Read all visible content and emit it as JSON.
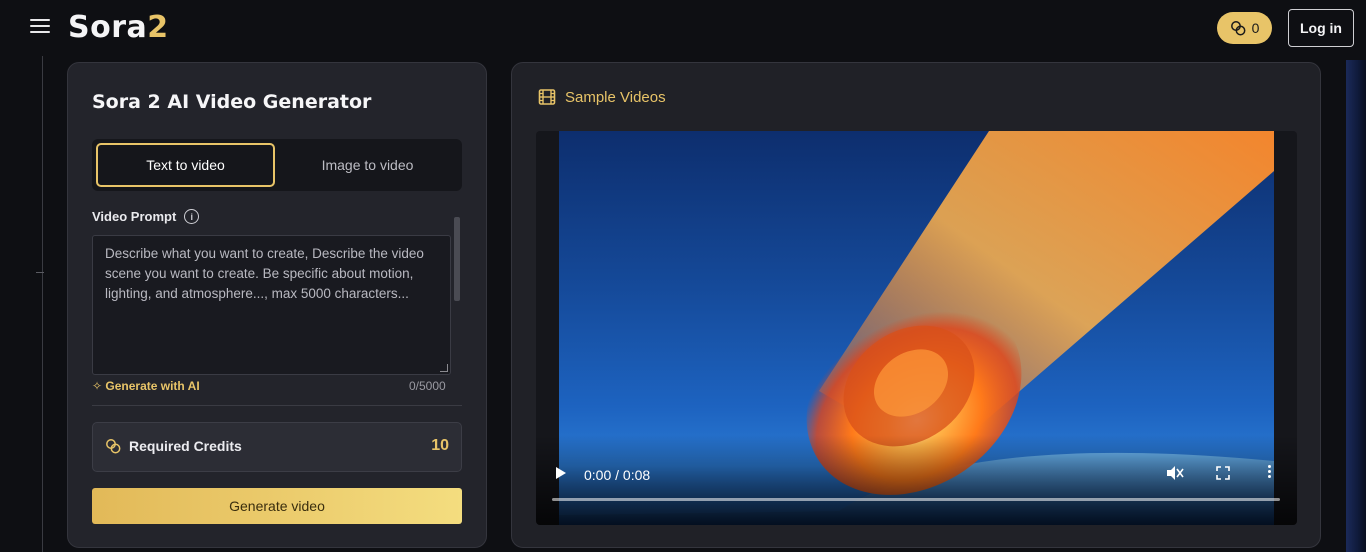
{
  "header": {
    "logo_white": "Sora",
    "logo_gold": "2",
    "credits_count": "0",
    "login_label": "Log in"
  },
  "generator": {
    "title": "Sora 2 AI Video Generator",
    "tabs": [
      {
        "label": "Text to video",
        "active": true
      },
      {
        "label": "Image to video",
        "active": false
      }
    ],
    "prompt_label": "Video Prompt",
    "prompt_value": "",
    "prompt_placeholder": "Describe what you want to create, Describe the video scene you want to create. Be specific about motion, lighting, and atmosphere..., max 5000 characters...",
    "generate_ai_label": "Generate with AI",
    "char_count": "0/5000",
    "required_credits_label": "Required Credits",
    "required_credits_value": "10",
    "generate_button_label": "Generate video"
  },
  "samples": {
    "title": "Sample Videos",
    "video": {
      "time_display": "0:00 / 0:08",
      "progress": 0,
      "muted": true
    }
  },
  "colors": {
    "accent": "#e8c468",
    "background": "#0e0f13",
    "panel": "#23242b"
  },
  "icons": [
    "menu-icon",
    "coins-icon",
    "info-icon",
    "sparkle-icon",
    "film-icon",
    "play-icon",
    "mute-icon",
    "fullscreen-icon",
    "more-icon"
  ]
}
